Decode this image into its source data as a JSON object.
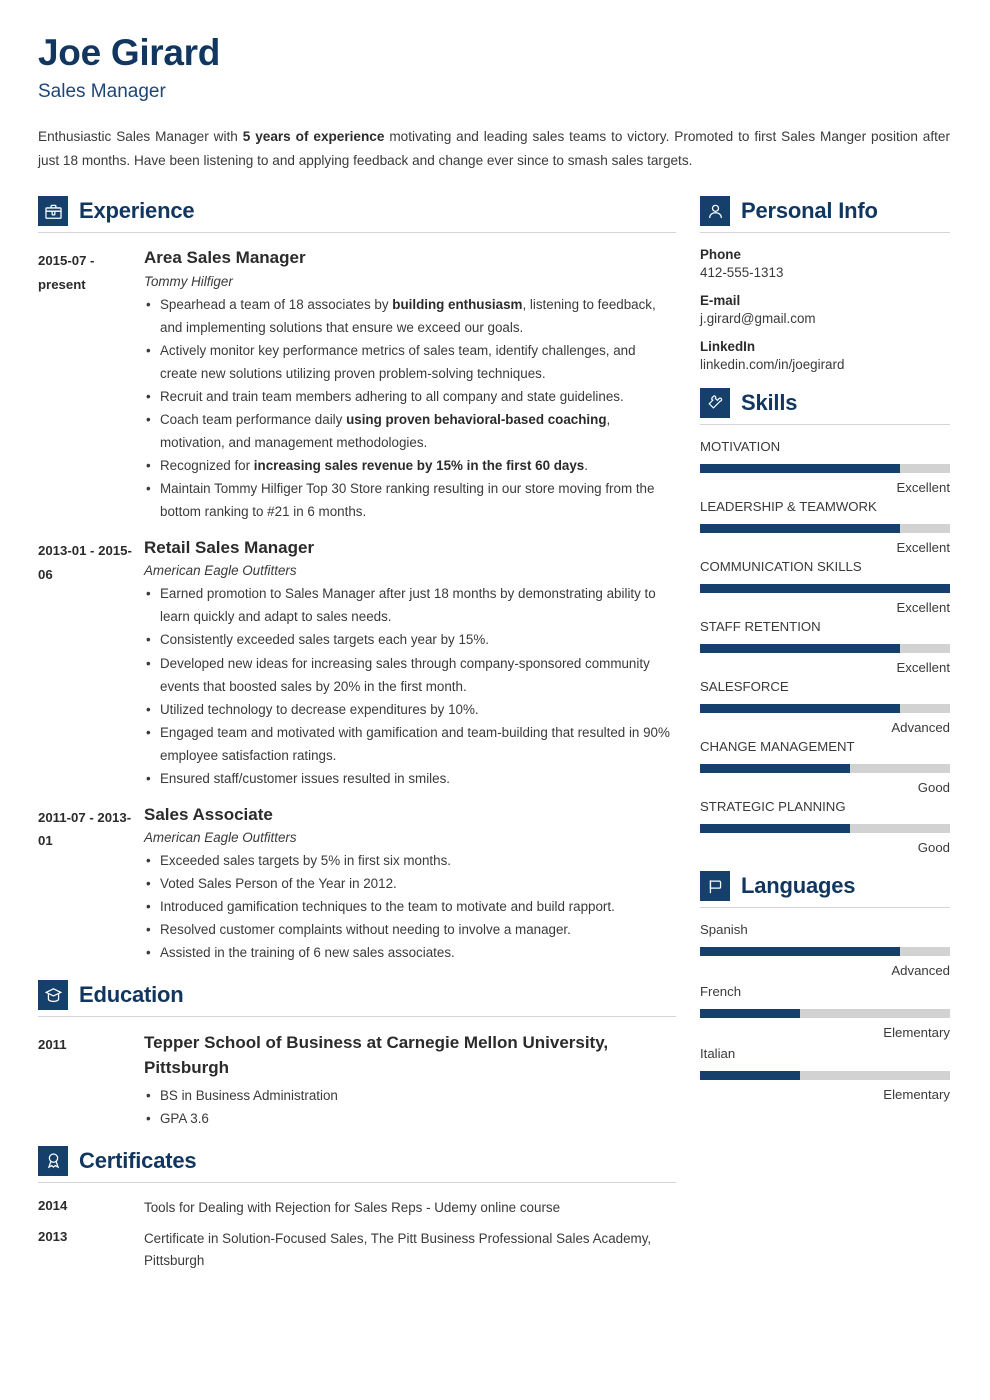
{
  "theme": {
    "navy": "#14406b",
    "heading_navy": "#11365f",
    "track_gray": "#d2d2d2"
  },
  "header": {
    "name": "Joe Girard",
    "job_title": "Sales Manager",
    "summary_part1": "Enthusiastic Sales Manager with ",
    "summary_bold": "5 years of experience",
    "summary_part2": " motivating and leading sales teams to victory. Promoted to first Sales Manger position after just 18 months. Have been listening to and applying feedback and change ever since to smash sales targets."
  },
  "sections": {
    "experience": {
      "title": "Experience",
      "icon": "briefcase-icon"
    },
    "education": {
      "title": "Education",
      "icon": "graduation-cap-icon"
    },
    "certificates": {
      "title": "Certificates",
      "icon": "award-ribbon-icon"
    },
    "personal_info": {
      "title": "Personal Info",
      "icon": "person-icon"
    },
    "skills": {
      "title": "Skills",
      "icon": "puzzle-piece-icon"
    },
    "languages": {
      "title": "Languages",
      "icon": "flag-icon"
    }
  },
  "experience": [
    {
      "date": "2015-07 - present",
      "role": "Area Sales Manager",
      "org": "Tommy Hilfiger",
      "bullets": [
        {
          "pre": "Spearhead a team of 18 associates by ",
          "bold": "building enthusiasm",
          "post": ", listening to feedback, and implementing solutions that ensure we exceed our goals."
        },
        {
          "pre": "Actively monitor key performance metrics of sales team, identify challenges, and create new solutions utilizing proven problem-solving techniques.",
          "bold": "",
          "post": ""
        },
        {
          "pre": "Recruit and train team members adhering to all company and state guidelines.",
          "bold": "",
          "post": ""
        },
        {
          "pre": "Coach team performance daily ",
          "bold": "using proven behavioral-based coaching",
          "post": ", motivation, and management methodologies."
        },
        {
          "pre": "Recognized for ",
          "bold": "increasing sales revenue by 15% in the first 60 days",
          "post": "."
        },
        {
          "pre": "Maintain Tommy Hilfiger Top 30 Store ranking resulting in our store moving from the bottom ranking to #21 in 6 months.",
          "bold": "",
          "post": ""
        }
      ]
    },
    {
      "date": "2013-01 - 2015-06",
      "role": "Retail Sales Manager",
      "org": "American Eagle Outfitters",
      "bullets": [
        {
          "pre": "Earned promotion to Sales Manager after just 18 months by demonstrating ability to learn quickly and adapt to sales needs.",
          "bold": "",
          "post": ""
        },
        {
          "pre": "Consistently exceeded sales targets each year by 15%.",
          "bold": "",
          "post": ""
        },
        {
          "pre": "Developed new ideas for increasing sales through company-sponsored community events that boosted sales by 20% in the first month.",
          "bold": "",
          "post": ""
        },
        {
          "pre": "Utilized technology to decrease expenditures by 10%.",
          "bold": "",
          "post": ""
        },
        {
          "pre": "Engaged team and motivated with gamification and team-building that resulted in 90% employee satisfaction ratings.",
          "bold": "",
          "post": ""
        },
        {
          "pre": "Ensured staff/customer issues resulted in smiles.",
          "bold": "",
          "post": ""
        }
      ]
    },
    {
      "date": "2011-07 - 2013-01",
      "role": "Sales Associate",
      "org": "American Eagle Outfitters",
      "bullets": [
        {
          "pre": "Exceeded sales targets by 5% in first six months.",
          "bold": "",
          "post": ""
        },
        {
          "pre": "Voted Sales Person of the Year in 2012.",
          "bold": "",
          "post": ""
        },
        {
          "pre": "Introduced gamification techniques to the team to motivate and build rapport.",
          "bold": "",
          "post": ""
        },
        {
          "pre": "Resolved customer complaints without needing to involve a manager.",
          "bold": "",
          "post": ""
        },
        {
          "pre": "Assisted in the training of 6 new sales associates.",
          "bold": "",
          "post": ""
        }
      ]
    }
  ],
  "education": [
    {
      "date": "2011",
      "school": "Tepper School of Business at Carnegie Mellon University, Pittsburgh",
      "bullets": [
        "BS in Business Administration",
        "GPA 3.6"
      ]
    }
  ],
  "certificates": [
    {
      "year": "2014",
      "text": "Tools for Dealing with Rejection for Sales Reps - Udemy online course"
    },
    {
      "year": "2013",
      "text": "Certificate in Solution-Focused Sales, The Pitt Business Professional Sales Academy, Pittsburgh"
    }
  ],
  "personal_info": [
    {
      "label": "Phone",
      "value": "412-555-1313"
    },
    {
      "label": "E-mail",
      "value": "j.girard@gmail.com"
    },
    {
      "label": "LinkedIn",
      "value": "linkedin.com/in/joegirard"
    }
  ],
  "skills": [
    {
      "name": "MOTIVATION",
      "level": "Excellent",
      "percent": 80
    },
    {
      "name": "LEADERSHIP & TEAMWORK",
      "level": "Excellent",
      "percent": 80
    },
    {
      "name": "COMMUNICATION SKILLS",
      "level": "Excellent",
      "percent": 100
    },
    {
      "name": "STAFF RETENTION",
      "level": "Excellent",
      "percent": 80
    },
    {
      "name": "SALESFORCE",
      "level": "Advanced",
      "percent": 80
    },
    {
      "name": "CHANGE MANAGEMENT",
      "level": "Good",
      "percent": 60
    },
    {
      "name": "STRATEGIC PLANNING",
      "level": "Good",
      "percent": 60
    }
  ],
  "languages": [
    {
      "name": "Spanish",
      "level": "Advanced",
      "percent": 80
    },
    {
      "name": "French",
      "level": "Elementary",
      "percent": 40
    },
    {
      "name": "Italian",
      "level": "Elementary",
      "percent": 40
    }
  ]
}
